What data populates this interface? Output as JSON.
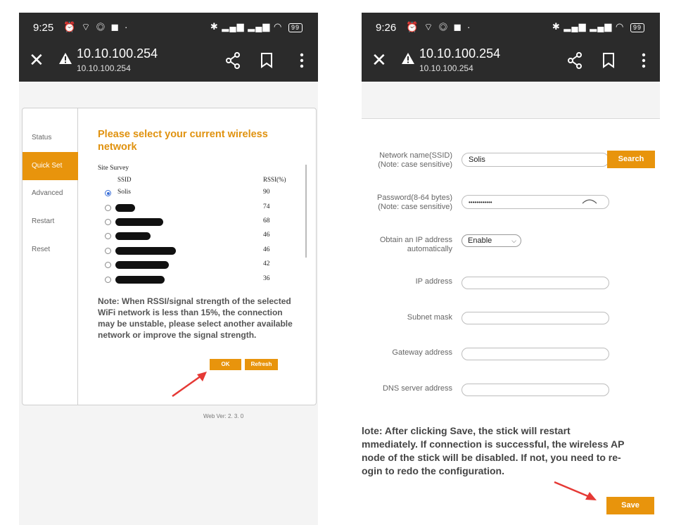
{
  "left": {
    "status": {
      "time": "9:25",
      "battery": "99"
    },
    "toolbar": {
      "url": "10.10.100.254",
      "url_sub": "10.10.100.254"
    },
    "sidebar": {
      "items": [
        {
          "label": "Status"
        },
        {
          "label": "Quick Set",
          "active": true
        },
        {
          "label": "Advanced"
        },
        {
          "label": "Restart"
        },
        {
          "label": "Reset"
        }
      ]
    },
    "main": {
      "title": "Please select your current wireless network",
      "site_survey": "Site Survey",
      "col_ssid": "SSID",
      "col_rssi": "RSSI(%)",
      "rows": [
        {
          "ssid": "Solis",
          "rssi": "90",
          "checked": true,
          "redacted": false
        },
        {
          "ssid": "",
          "rssi": "74",
          "checked": false,
          "redacted": true
        },
        {
          "ssid": "",
          "rssi": "68",
          "checked": false,
          "redacted": true
        },
        {
          "ssid": "",
          "rssi": "46",
          "checked": false,
          "redacted": true
        },
        {
          "ssid": "",
          "rssi": "46",
          "checked": false,
          "redacted": true
        },
        {
          "ssid": "",
          "rssi": "42",
          "checked": false,
          "redacted": true
        },
        {
          "ssid": "",
          "rssi": "36",
          "checked": false,
          "redacted": true
        }
      ],
      "note": "Note: When RSSI/signal strength of the selected WiFi network is less than 15%, the connection may be unstable, please select another available network or improve the signal strength.",
      "ok_label": "OK",
      "refresh_label": "Refresh"
    },
    "web_ver": "Web Ver: 2. 3. 0"
  },
  "right": {
    "status": {
      "time": "9:26",
      "battery": "99"
    },
    "toolbar": {
      "url": "10.10.100.254",
      "url_sub": "10.10.100.254"
    },
    "form": {
      "ssid_label_1": "Network name(SSID)",
      "ssid_label_2": "(Note: case sensitive)",
      "ssid_value": "Solis",
      "search_label": "Search",
      "password_label_1": "Password(8-64 bytes)",
      "password_label_2": "(Note: case sensitive)",
      "password_value": "••••••••••••",
      "obtain_ip_label_1": "Obtain an IP address",
      "obtain_ip_label_2": "automatically",
      "obtain_ip_value": "Enable",
      "ip_label": "IP address",
      "subnet_label": "Subnet mask",
      "gateway_label": "Gateway address",
      "dns_label": "DNS server address",
      "ip_value": "",
      "subnet_value": "",
      "gateway_value": "",
      "dns_value": ""
    },
    "note": "lote: After clicking Save, the stick will restart\nmmediately. If connection is successful, the wireless AP\nnode of the stick will be disabled. If not, you need to re-\nogin to redo the configuration.",
    "save_label": "Save"
  },
  "colors": {
    "accent": "#e8940c",
    "toolbar": "#2b2b2b",
    "arrow": "#e53935"
  }
}
